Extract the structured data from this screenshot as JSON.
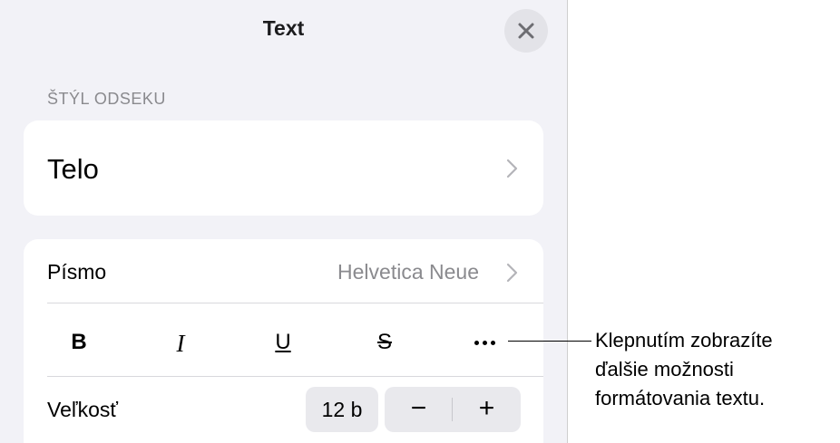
{
  "header": {
    "title": "Text",
    "close_icon": "close-icon"
  },
  "paragraph_style": {
    "section_label": "ŠTÝL ODSEKU",
    "value": "Telo"
  },
  "font": {
    "label": "Písmo",
    "value": "Helvetica Neue"
  },
  "format_buttons": {
    "bold": "B",
    "italic": "I",
    "underline": "U",
    "strikethrough": "S",
    "more_icon": "ellipsis-icon"
  },
  "size": {
    "label": "Veľkosť",
    "value": "12 b",
    "decrease": "−",
    "increase": "+"
  },
  "callout": {
    "lines": [
      "Klepnutím zobrazíte",
      "ďalšie možnosti",
      "formátovania textu."
    ]
  },
  "colors": {
    "panel_bg": "#f2f2f7",
    "card_bg": "#ffffff",
    "secondary_text": "#8a8a8e"
  }
}
